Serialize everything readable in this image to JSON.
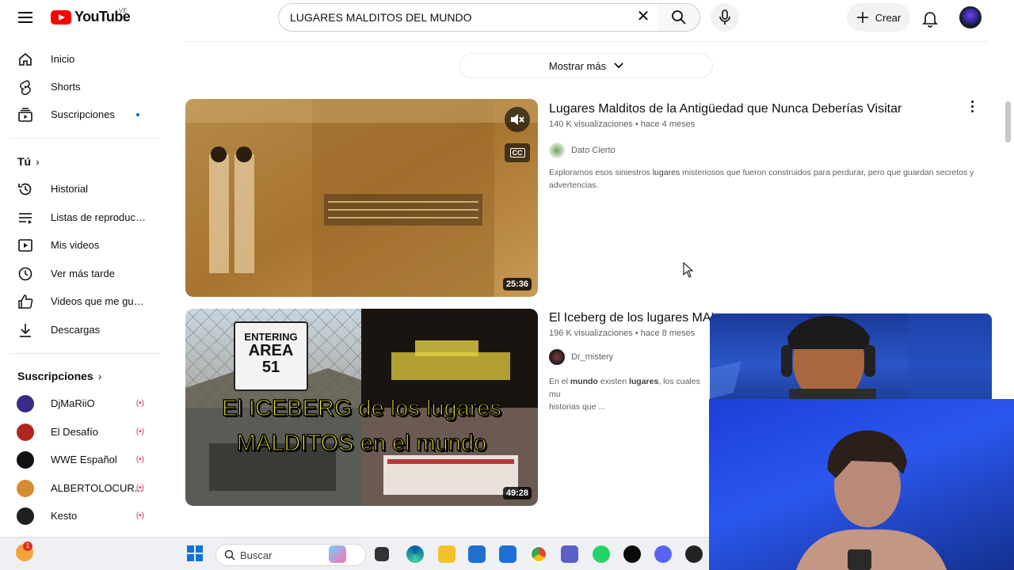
{
  "header": {
    "logo_text": "YouTube",
    "logo_country": "VE",
    "search_value": "LUGARES MALDITOS DEL MUNDO",
    "clear_symbol": "✕",
    "create_label": "Crear"
  },
  "sidebar": {
    "main": [
      {
        "label": "Inicio",
        "icon": "home-icon"
      },
      {
        "label": "Shorts",
        "icon": "shorts-icon"
      },
      {
        "label": "Suscripciones",
        "icon": "subscriptions-icon"
      }
    ],
    "you_heading": "Tú",
    "you_items": [
      {
        "label": "Historial",
        "icon": "history-icon"
      },
      {
        "label": "Listas de reproducc...",
        "icon": "playlists-icon"
      },
      {
        "label": "Mis videos",
        "icon": "my-videos-icon"
      },
      {
        "label": "Ver más tarde",
        "icon": "watch-later-icon"
      },
      {
        "label": "Videos que me gus...",
        "icon": "liked-icon"
      },
      {
        "label": "Descargas",
        "icon": "downloads-icon"
      }
    ],
    "subs_heading": "Suscripciones",
    "subscriptions": [
      {
        "label": "DjMaRiiO",
        "color": "#3b2a88"
      },
      {
        "label": "El Desafío",
        "color": "#b3261e"
      },
      {
        "label": "WWE Español",
        "color": "#111111"
      },
      {
        "label": "ALBERTOLOCUR...",
        "color": "#d78b2f"
      },
      {
        "label": "Kesto",
        "color": "#1f1f1f"
      }
    ]
  },
  "main": {
    "show_more": "Mostrar más",
    "videos": [
      {
        "title": "Lugares Malditos de la Antigüedad que Nunca Deberías Visitar",
        "views": "140 K visualizaciones",
        "age": "hace 4 meses",
        "channel": "Dato Cierto",
        "description_parts": [
          "Exploramos esos siniestros ",
          "lugares",
          " misteriosos que fueron construidos para perdurar, pero que guardan secretos y advertencias."
        ],
        "duration": "25:36"
      },
      {
        "title": "El Iceberg de los lugares MAL",
        "views": "196 K visualizaciones",
        "age": "hace 8 meses",
        "channel": "Dr_mistery",
        "description_parts": [
          "En el ",
          "mundo",
          " existen ",
          "lugares",
          ", los cuales mu",
          "historias que ..."
        ],
        "duration": "49:28",
        "thumb_sign_line1": "ENTERING",
        "thumb_sign_line2": "AREA",
        "thumb_sign_line3": "51",
        "thumb_caption_1": "El ICEBERG de los lugares",
        "thumb_caption_2": "MALDITOS en el mundo"
      }
    ]
  },
  "taskbar": {
    "search_label": "Buscar",
    "notif_count": "1"
  },
  "colors": {
    "brand_red": "#ff0000",
    "live_red": "#e0245e",
    "caption_yellow": "#f7f02a"
  }
}
